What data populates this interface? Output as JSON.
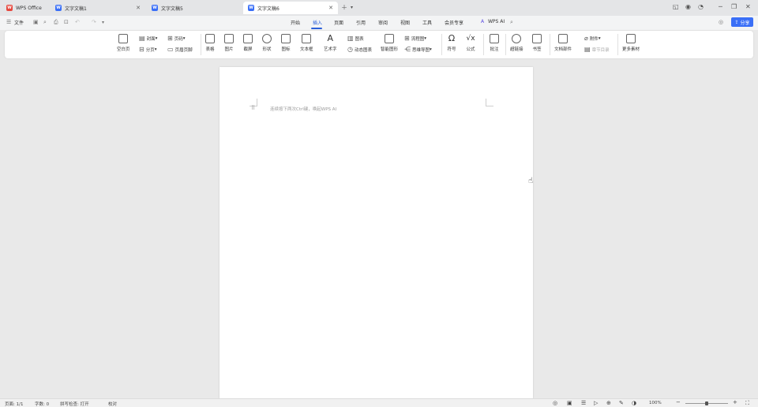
{
  "tabs": [
    {
      "label": "WPS Office",
      "logo_color": "#e6493f"
    },
    {
      "label": "文字文稿1",
      "logo_color": "#3a6ff7"
    },
    {
      "label": "文字文稿5",
      "logo_color": "#3a6ff7"
    },
    {
      "label": "文字文稿6",
      "logo_color": "#3a6ff7"
    }
  ],
  "menu": {
    "file": "文件",
    "items": [
      "开始",
      "插入",
      "页面",
      "引用",
      "审阅",
      "视图",
      "工具",
      "会员专享"
    ],
    "active": "插入",
    "wps_ai": "WPS AI",
    "share": "分享"
  },
  "ribbon": {
    "blank_page": "空白页",
    "cover": "封面",
    "page_break": "分页",
    "page_number": "页码",
    "header_footer": "页眉页脚",
    "table": "表格",
    "picture": "图片",
    "screenshot": "截屏",
    "shape": "形状",
    "icon": "图标",
    "textbox": "文本框",
    "wordart": "艺术字",
    "chart": "图表",
    "dynamic_chart": "动态图表",
    "smart_art": "智能图形",
    "flowchart": "流程图",
    "mindmap": "思维导图",
    "symbol": "符号",
    "formula": "公式",
    "comment": "批注",
    "hyperlink": "超链接",
    "bookmark": "书签",
    "doc_component": "文档部件",
    "attachment": "附件",
    "catalog": "章节目录",
    "more": "更多素材"
  },
  "document": {
    "placeholder": "连续按下两次Ctrl键，唤起WPS AI"
  },
  "status": {
    "page": "页面: 1/1",
    "words": "字数: 0",
    "spell": "拼写检查: 打开",
    "proof": "校对",
    "zoom": "100%"
  }
}
